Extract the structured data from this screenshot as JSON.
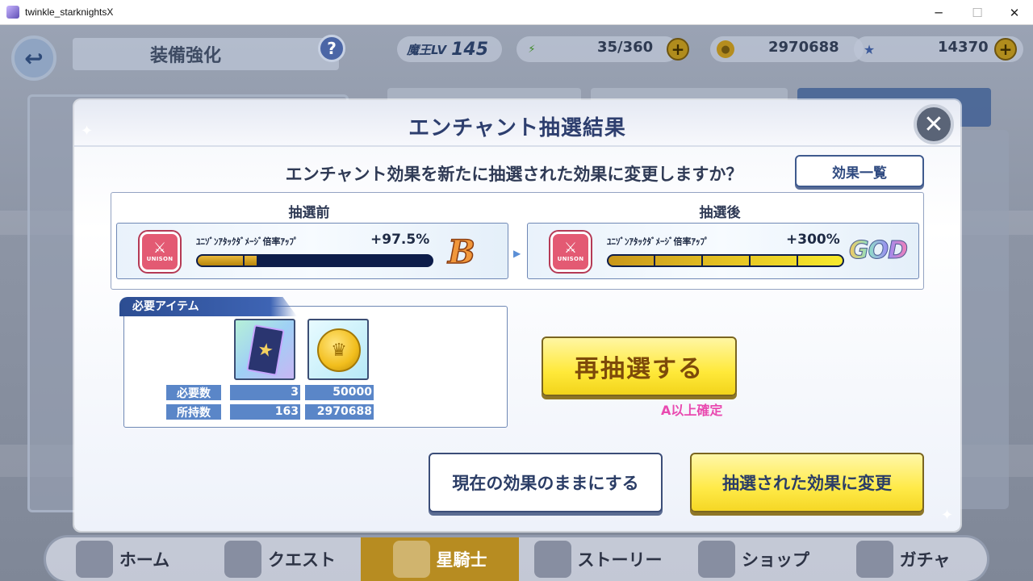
{
  "window": {
    "title": "twinkle_starknightsX",
    "minimize": "─",
    "maximize": "☐",
    "close": "✕"
  },
  "header": {
    "back_icon": "↩",
    "title": "装備強化",
    "help": "?",
    "lv_label": "魔王LV",
    "lv_value": "145",
    "stamina": "35/360",
    "coins": "2970688",
    "stars": "14370",
    "plus": "+"
  },
  "modal": {
    "title": "エンチャント抽選結果",
    "close_icon": "✕",
    "question": "エンチャント効果を新たに抽選された効果に変更しますか？",
    "effect_list_button": "効果一覧",
    "before": {
      "label": "抽選前",
      "effect_name": "ﾕﾆｿﾞﾝｱﾀｯｸﾀﾞﾒｰｼﾞ倍率ｱｯﾌﾟ",
      "value": "+97.5%",
      "grade": "B",
      "gauge_fraction": 0.25,
      "icon": "UNISON"
    },
    "after": {
      "label": "抽選後",
      "effect_name": "ﾕﾆｿﾞﾝｱﾀｯｸﾀﾞﾒｰｼﾞ倍率ｱｯﾌﾟ",
      "value": "+300%",
      "grade": "GOD",
      "gauge_fraction": 1.0,
      "icon": "UNISON"
    },
    "required_items": {
      "title": "必要アイテム",
      "required_label": "必要数",
      "owned_label": "所持数",
      "items": [
        {
          "name": "ticket-icon",
          "required": "3",
          "owned": "163"
        },
        {
          "name": "coin-icon",
          "required": "50000",
          "owned": "2970688"
        }
      ]
    },
    "reroll_button": "再抽選する",
    "reroll_note": "A以上確定",
    "keep_button": "現在の効果のままにする",
    "change_button": "抽選された効果に変更"
  },
  "bottom_nav": {
    "items": [
      {
        "label": "ホーム"
      },
      {
        "label": "クエスト"
      },
      {
        "label": "星騎士"
      },
      {
        "label": "ストーリー"
      },
      {
        "label": "ショップ"
      },
      {
        "label": "ガチャ"
      }
    ]
  },
  "colors": {
    "accent_blue": "#2d3e6e",
    "gold_button": "#ffe93a",
    "pink_note": "#e94ab0",
    "gauge_before": "#c99a1a",
    "gauge_after": "#f2dc2a"
  }
}
